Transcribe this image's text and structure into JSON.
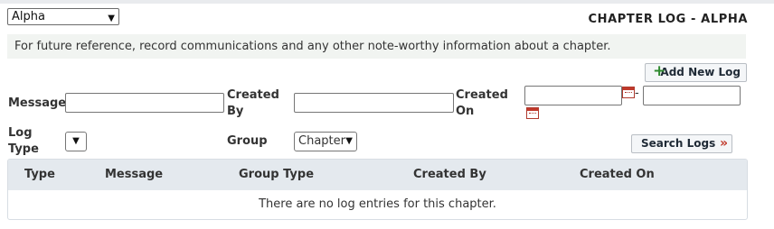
{
  "chapter_select": {
    "value": "Alpha"
  },
  "page_title": "CHAPTER LOG - ALPHA",
  "info_text": "For future reference, record communications and any other note-worthy information about a chapter.",
  "add_button": {
    "label": "Add New Log",
    "icon": "plus-icon"
  },
  "filters": {
    "message_label": "Message",
    "created_by_label": "Created\nBy",
    "created_on_label": "Created\nOn",
    "log_type_label": "Log\nType",
    "group_label": "Group",
    "group_value": "Chapter",
    "date_separator": "-",
    "message_value": "",
    "created_by_value": "",
    "created_on_from": "",
    "created_on_to": ""
  },
  "search_button": {
    "label": "Search Logs",
    "icon": "double-chevron-right-icon"
  },
  "table": {
    "columns": [
      "Type",
      "Message",
      "Group Type",
      "Created By",
      "Created On"
    ],
    "empty_message": "There are no log entries for this chapter."
  },
  "colors": {
    "accent_red": "#c0392b",
    "plus_green": "#2f8a2f",
    "header_bg": "#e4e9ee",
    "info_bg": "#f1f4f1"
  }
}
